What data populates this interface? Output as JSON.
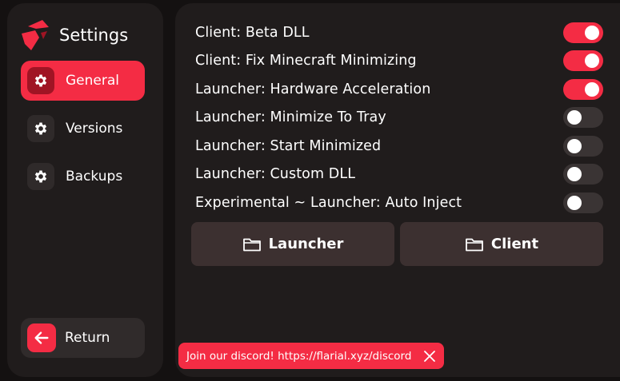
{
  "app": {
    "title": "Settings"
  },
  "sidebar": {
    "items": [
      {
        "label": "General",
        "icon": "gear-icon",
        "active": true
      },
      {
        "label": "Versions",
        "icon": "gear-icon",
        "active": false
      },
      {
        "label": "Backups",
        "icon": "gear-icon",
        "active": false
      }
    ],
    "return_label": "Return"
  },
  "settings": [
    {
      "label": "Client: Beta DLL",
      "enabled": true
    },
    {
      "label": "Client: Fix Minecraft Minimizing",
      "enabled": true
    },
    {
      "label": "Launcher: Hardware Acceleration",
      "enabled": true
    },
    {
      "label": "Launcher: Minimize To Tray",
      "enabled": false
    },
    {
      "label": "Launcher: Start Minimized",
      "enabled": false
    },
    {
      "label": "Launcher: Custom DLL",
      "enabled": false
    },
    {
      "label": "Experimental ~ Launcher: Auto Inject",
      "enabled": false
    }
  ],
  "folders": {
    "launcher_label": "Launcher",
    "client_label": "Client"
  },
  "toast": {
    "text": "Join our discord! https://flarial.xyz/discord"
  },
  "colors": {
    "accent": "#f42c44",
    "panel": "#201c1c",
    "background": "#141111",
    "toggle_off": "#3a3434"
  }
}
